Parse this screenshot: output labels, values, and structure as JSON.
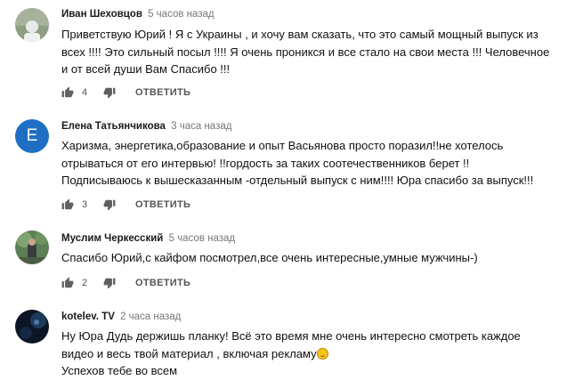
{
  "comments": [
    {
      "author": "Иван Шеховцов",
      "time": "5 часов назад",
      "lines": [
        "Приветствую  Юрий ! Я с Украины , и хочу вам сказать, что это самый мощный выпуск из",
        "всех !!!! Это сильный посыл !!!! Я очень проникся и все стало на свои места !!! Человечное",
        "и от всей души Вам Спасибо !!!"
      ],
      "likes": "4",
      "reply_label": "ОТВЕТИТЬ",
      "avatar_color": "#8a9a7a"
    },
    {
      "author": "Елена Татьянчикова",
      "time": "3 часа назад",
      "lines": [
        "Харизма, энергетика,образование и опыт   Васьянова  просто поразил!!не хотелось",
        "отрываться от его интервью! !!гордость за таких соотечественников берет !!",
        "Подписываюсь  к вышесказанным -отдельный выпуск с ним!!!! Юра спасибо за выпуск!!!"
      ],
      "likes": "3",
      "reply_label": "ОТВЕТИТЬ",
      "avatar_letter": "Е",
      "avatar_color": "#1e6fc4"
    },
    {
      "author": "Муслим Черкесский",
      "time": "5 часов назад",
      "lines": [
        "Спасибо Юрий,с кайфом посмотрел,все очень интересные,умные мужчины-)"
      ],
      "likes": "2",
      "reply_label": "ОТВЕТИТЬ",
      "avatar_color": "#4a6a48"
    },
    {
      "author": "kotelev. TV",
      "time": "2 часа назад",
      "lines": [
        "Ну Юра Дудь держишь планку! Всё это время мне очень интересно смотреть каждое",
        "видео и весь твой материал , включая рекламу",
        "Успехов тебе во всем"
      ],
      "avatar_color": "#0d1a2a"
    }
  ],
  "icons": {
    "like": "thumbs-up-icon",
    "dislike": "thumbs-down-icon",
    "emoji": "laughing-emoji-icon"
  }
}
